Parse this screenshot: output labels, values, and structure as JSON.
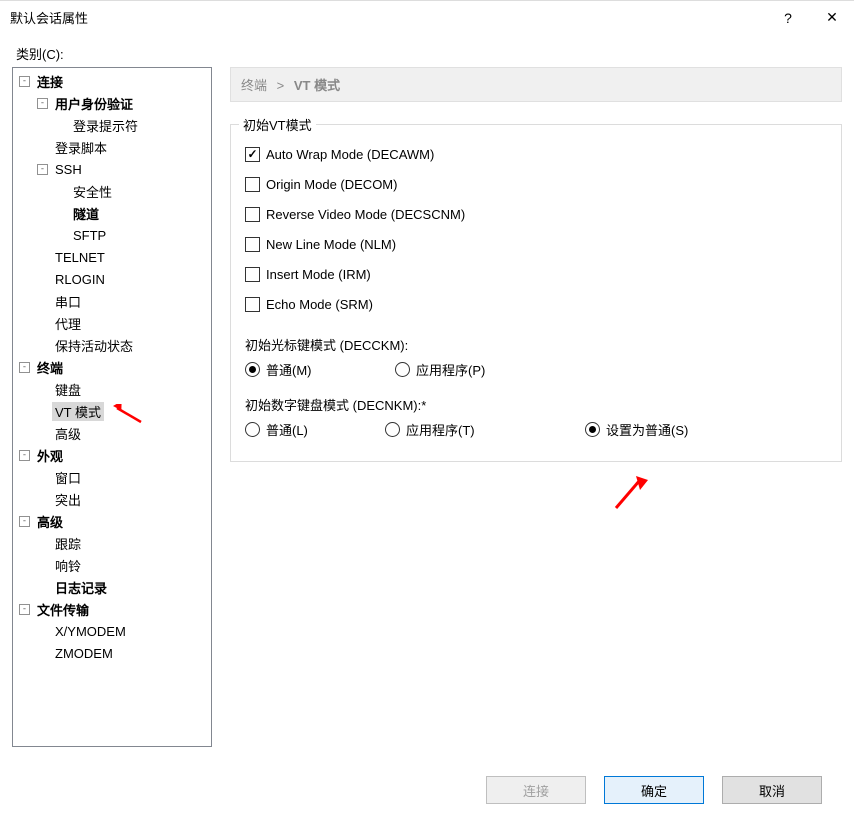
{
  "titlebar": {
    "title": "默认会话属性",
    "help": "?",
    "close": "✕"
  },
  "category_label": "类别(C):",
  "tree": {
    "connection": "连接",
    "auth": "用户身份验证",
    "login_prompt": "登录提示符",
    "login_script": "登录脚本",
    "ssh": "SSH",
    "security": "安全性",
    "tunnel": "隧道",
    "sftp": "SFTP",
    "telnet": "TELNET",
    "rlogin": "RLOGIN",
    "serial": "串口",
    "proxy": "代理",
    "keepalive": "保持活动状态",
    "terminal": "终端",
    "keyboard": "键盘",
    "vt_mode": "VT 模式",
    "adv": "高级",
    "appearance": "外观",
    "window": "窗口",
    "highlight": "突出",
    "advanced": "高级",
    "trace": "跟踪",
    "bell": "响铃",
    "logging": "日志记录",
    "file_transfer": "文件传输",
    "xymodem": "X/YMODEM",
    "zmodem": "ZMODEM"
  },
  "breadcrumb": {
    "a": "终端",
    "sep": ">",
    "b": "VT 模式"
  },
  "group": {
    "title": "初始VT模式",
    "checks": {
      "autowrap": "Auto Wrap Mode (DECAWM)",
      "origin": "Origin Mode (DECOM)",
      "reverse": "Reverse Video Mode (DECSCNM)",
      "newline": "New Line Mode (NLM)",
      "insert": "Insert Mode (IRM)",
      "echo": "Echo Mode (SRM)"
    },
    "cursor_label": "初始光标键模式 (DECCKM):",
    "cursor_opts": {
      "normal": "普通(M)",
      "app": "应用程序(P)"
    },
    "keypad_label": "初始数字键盘模式 (DECNKM):*",
    "keypad_opts": {
      "normal": "普通(L)",
      "app": "应用程序(T)",
      "set_normal": "设置为普通(S)"
    }
  },
  "buttons": {
    "connect": "连接",
    "ok": "确定",
    "cancel": "取消"
  }
}
